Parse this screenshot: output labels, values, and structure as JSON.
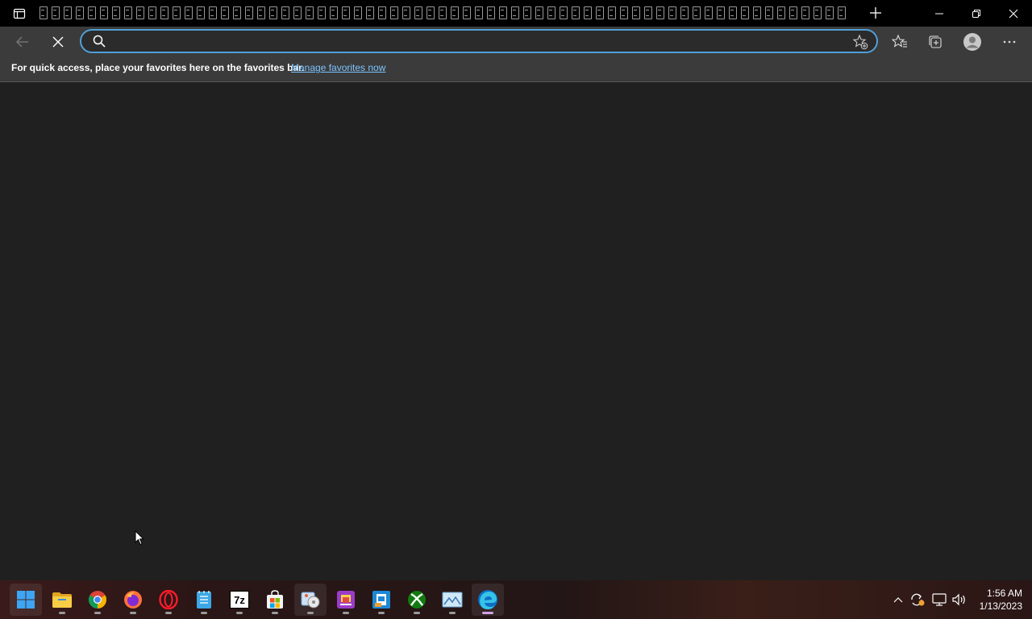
{
  "address_bar": {
    "value": "",
    "placeholder": ""
  },
  "favorites_bar": {
    "message": "For quick access, place your favorites here on the favorites bar.",
    "link": "Manage favorites now"
  },
  "tabs": {
    "count": 67
  },
  "taskbar": {
    "apps": [
      "start-icon",
      "file-explorer-icon",
      "chrome-icon",
      "firefox-icon",
      "opera-icon",
      "notepad-icon",
      "7zip-icon",
      "microsoft-store-icon",
      "media-player-icon",
      "purple-app-icon",
      "blue-app-icon",
      "xbox-icon",
      "photo-viewer-icon",
      "edge-icon"
    ],
    "sevenzip_label": "7z"
  },
  "clock": {
    "time": "1:56 AM",
    "date": "1/13/2023"
  },
  "colors": {
    "accent": "#4fa0d8",
    "link": "#7cc4ff",
    "background": "#202020"
  }
}
